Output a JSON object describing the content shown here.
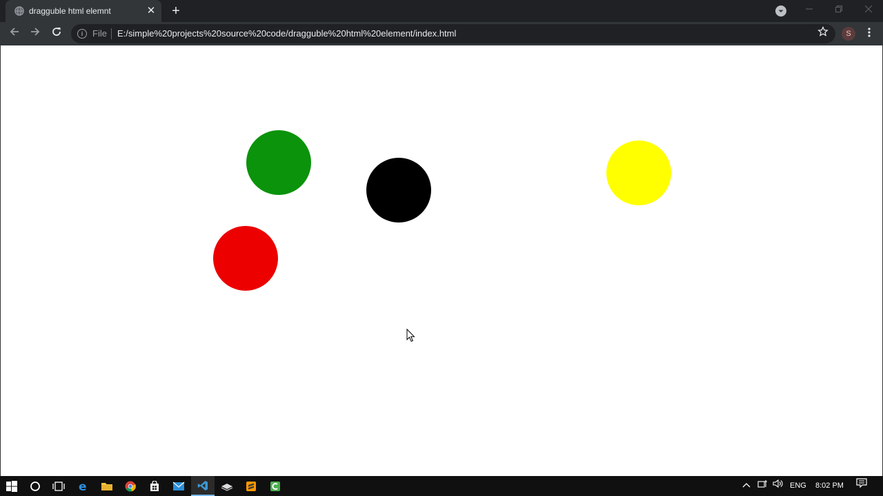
{
  "browser": {
    "tab_title": "dragguble html elemnt",
    "tab_close": "✕",
    "new_tab": "+",
    "omnibox": {
      "scheme_label": "File",
      "url": "E:/simple%20projects%20source%20code/dragguble%20html%20element/index.html"
    },
    "profile_initial": "S",
    "icons": {
      "back": "arrow-left-icon",
      "forward": "arrow-right-icon",
      "reload": "reload-icon",
      "info": "info-icon",
      "star": "star-icon",
      "menu": "kebab-menu-icon"
    }
  },
  "page": {
    "balls": [
      {
        "name": "green-ball",
        "color": "#0b930b"
      },
      {
        "name": "black-ball",
        "color": "#000000"
      },
      {
        "name": "yellow-ball",
        "color": "#ffff00"
      },
      {
        "name": "red-ball",
        "color": "#ec0000"
      }
    ]
  },
  "taskbar": {
    "apps": [
      "windows-start-icon",
      "cortana-icon",
      "task-view-icon",
      "edge-icon",
      "file-explorer-icon",
      "chrome-icon",
      "store-icon",
      "mail-icon",
      "vscode-icon",
      "app-icon",
      "sublime-icon",
      "camtasia-icon"
    ],
    "language": "ENG",
    "time": "8:02 PM"
  }
}
